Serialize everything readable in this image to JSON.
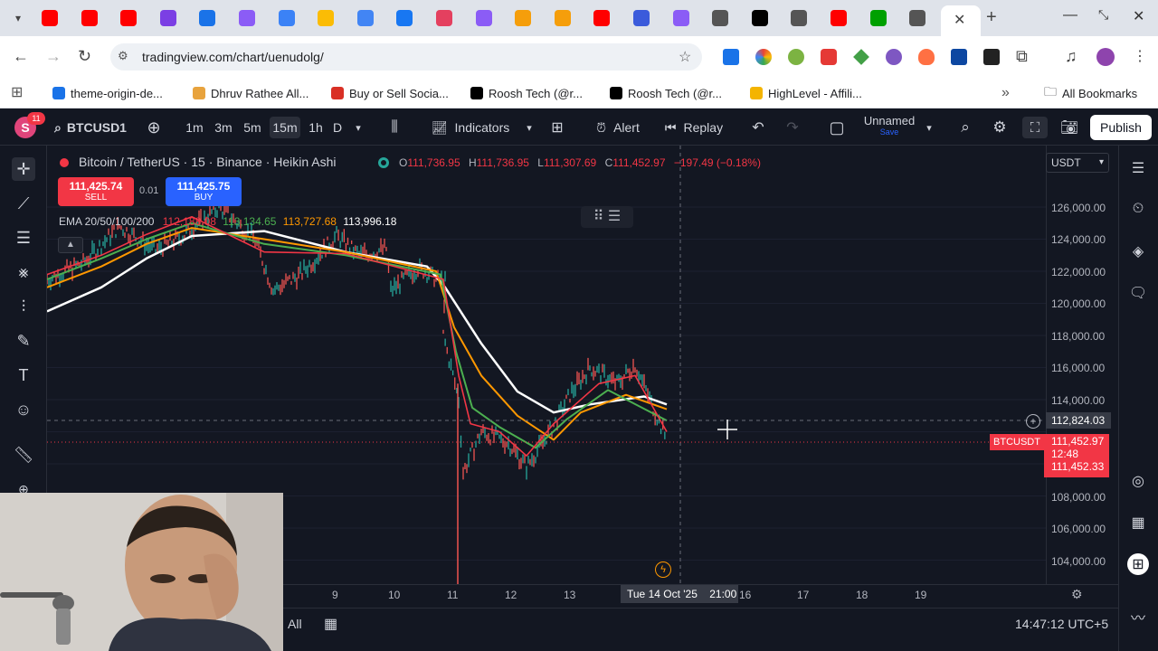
{
  "browser": {
    "url": "tradingview.com/chart/uenudolg/",
    "tab_colors": [
      "#ff0000",
      "#ff0000",
      "#ff0000",
      "#7b3fe4",
      "#1a73e8",
      "#8b5cf6",
      "#3b82f6",
      "#fbbc05",
      "#4285f4",
      "#1877f2",
      "#e4405f",
      "#8b5cf6",
      "#f59e0b",
      "#f59e0b",
      "#ff0000",
      "#3b5bdb",
      "#8b5cf6",
      "#555555",
      "#000000",
      "#555555",
      "#ff0000",
      "#00a000",
      "#555555"
    ],
    "bookmarks": [
      {
        "label": "theme-origin-de...",
        "icon_color": "#1a73e8"
      },
      {
        "label": "Dhruv Rathee All...",
        "icon_color": "#e8a33d"
      },
      {
        "label": "Buy or Sell Socia...",
        "icon_color": "#d93025"
      },
      {
        "label": "Roosh Tech (@r...",
        "icon_color": "#000000"
      },
      {
        "label": "Roosh Tech (@r...",
        "icon_color": "#000000"
      },
      {
        "label": "HighLevel - Affili...",
        "icon_color": "#f4b400"
      }
    ],
    "all_bookmarks": "All Bookmarks",
    "more_bookmarks": "»"
  },
  "toolbar": {
    "avatar_letter": "S",
    "avatar_badge": "11",
    "symbol": "BTCUSD1",
    "intervals": [
      "1m",
      "3m",
      "5m",
      "15m",
      "1h",
      "D"
    ],
    "selected_interval": "15m",
    "indicators": "Indicators",
    "alert": "Alert",
    "replay": "Replay",
    "layout_name": "Unnamed",
    "layout_status": "Save",
    "publish": "Publish"
  },
  "legend": {
    "title": "Bitcoin / TetherUS · 15 · Binance · Heikin Ashi",
    "o_label": "O",
    "o": "111,736.95",
    "h_label": "H",
    "h": "111,736.95",
    "l_label": "L",
    "l": "111,307.69",
    "c_label": "C",
    "c": "111,452.97",
    "change": "−197.49 (−0.18%)",
    "sell_price": "111,425.74",
    "sell_label": "SELL",
    "spread": "0.01",
    "buy_price": "111,425.75",
    "buy_label": "BUY",
    "ema_label": "EMA 20/50/100/200",
    "ema_values": [
      {
        "value": "112,188.08",
        "color": "#f23645"
      },
      {
        "value": "113,134.65",
        "color": "#4caf50"
      },
      {
        "value": "113,727.68",
        "color": "#ff9800"
      },
      {
        "value": "113,996.18",
        "color": "#ffffff"
      }
    ]
  },
  "price_scale": {
    "currency": "USDT",
    "labels": [
      "126,000.00",
      "124,000.00",
      "122,000.00",
      "120,000.00",
      "118,000.00",
      "116,000.00",
      "114,000.00",
      "108,000.00",
      "106,000.00",
      "104,000.00"
    ],
    "crosshair_price": "112,824.03",
    "symbol_tag": "BTCUSDT",
    "last_price": "111,452.97",
    "countdown": "12:48",
    "second_price": "111,452.33"
  },
  "time_scale": {
    "labels": [
      "9",
      "10",
      "11",
      "12",
      "13",
      "16",
      "17",
      "18",
      "19"
    ],
    "crosshair_time": "Tue 14 Oct '25",
    "crosshair_clock": "21:00"
  },
  "bottom": {
    "range_all": "All",
    "clock": "14:47:12 UTC+5"
  },
  "colors": {
    "bg": "#131722",
    "up": "#26a69a",
    "down": "#ef5350",
    "accent": "#2962ff"
  }
}
